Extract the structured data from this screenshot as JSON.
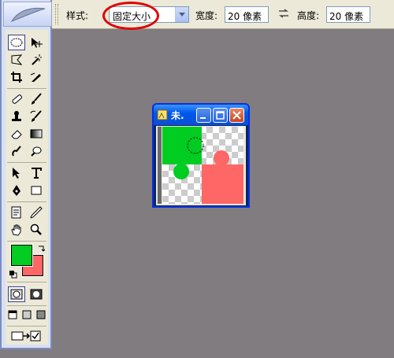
{
  "options_bar": {
    "style_label": "样式:",
    "style_value": "固定大小",
    "width_label": "宽度:",
    "width_value": "20 像素",
    "height_label": "高度:",
    "height_value": "20 像素"
  },
  "document": {
    "title": "未."
  },
  "colors": {
    "foreground": "#00cc22",
    "background": "#ff6666",
    "annotation": "#e00000",
    "workspace": "#807c80"
  },
  "tools": [
    "elliptical-marquee-icon",
    "move-icon",
    "polygonal-lasso-icon",
    "magic-wand-icon",
    "crop-icon",
    "slice-icon",
    "healing-brush-icon",
    "brush-icon",
    "clone-stamp-icon",
    "history-brush-icon",
    "eraser-icon",
    "gradient-icon",
    "smudge-icon",
    "dodge-icon",
    "path-selection-icon",
    "type-icon",
    "pen-icon",
    "rectangle-shape-icon",
    "notes-icon",
    "eyedropper-icon",
    "hand-icon",
    "zoom-icon"
  ]
}
